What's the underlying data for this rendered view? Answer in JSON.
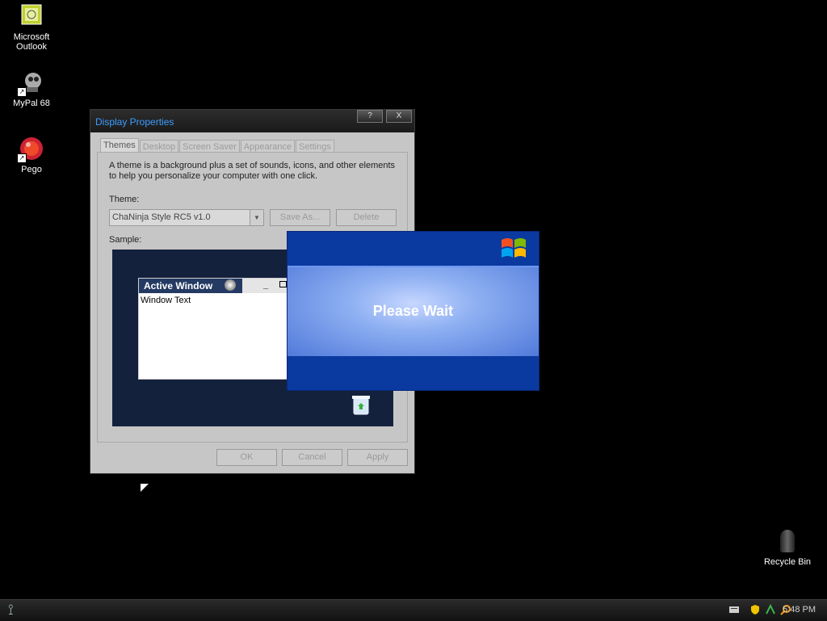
{
  "desktop": {
    "icons": [
      {
        "label_line1": "Microsoft",
        "label_line2": "Outlook"
      },
      {
        "label": "MyPal 68"
      },
      {
        "label": "Pego"
      }
    ],
    "recycle_bin_label": "Recycle Bin"
  },
  "display_properties": {
    "title": "Display Properties",
    "title_buttons": {
      "help": "?",
      "close": "X"
    },
    "tabs": [
      "Themes",
      "Desktop",
      "Screen Saver",
      "Appearance",
      "Settings"
    ],
    "description": "A theme is a background plus a set of sounds, icons, and other elements to help you personalize your computer with one click.",
    "theme_label": "Theme:",
    "theme_value": "ChaNinja Style RC5 v1.0",
    "save_as": "Save As...",
    "delete": "Delete",
    "sample_label": "Sample:",
    "sample_active_window": "Active Window",
    "sample_window_text": "Window Text",
    "ok": "OK",
    "cancel": "Cancel",
    "apply": "Apply"
  },
  "please_wait": {
    "message": "Please Wait"
  },
  "taskbar": {
    "clock": "5:48 PM"
  },
  "colors": {
    "title_text": "#3c9cff",
    "wait_blue": "#0a3aa0"
  }
}
